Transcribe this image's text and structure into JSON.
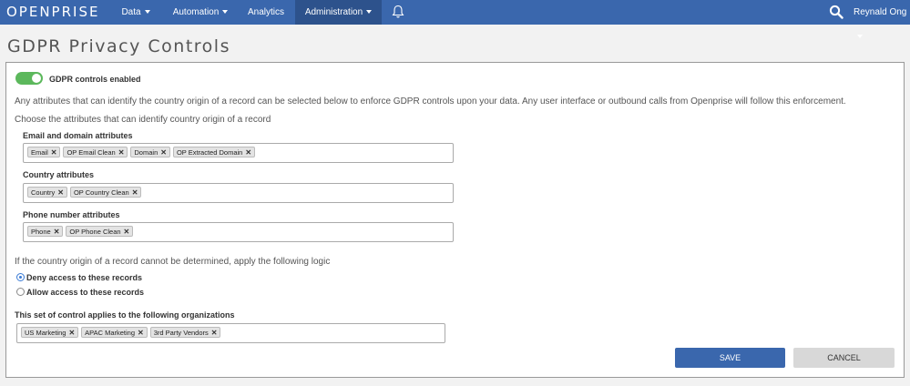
{
  "nav": {
    "logo": "OPENPRISE",
    "items": [
      {
        "label": "Data",
        "dropdown": true
      },
      {
        "label": "Automation",
        "dropdown": true
      },
      {
        "label": "Analytics",
        "dropdown": false
      },
      {
        "label": "Administration",
        "dropdown": true,
        "active": true
      }
    ],
    "user": "Reynald Ong",
    "bg_color": "#3a67ad"
  },
  "page": {
    "title": "GDPR Privacy Controls"
  },
  "gdpr": {
    "toggle_label": "GDPR controls enabled",
    "toggle_on": true,
    "description": "Any attributes that can identify the country origin of a record can be selected below to enforce GDPR controls upon your data. Any user interface or outbound calls from Openprise will follow this enforcement.",
    "choose_label": "Choose the attributes that can identify country origin of a record",
    "email_group": {
      "label": "Email and domain attributes",
      "tags": [
        "Email",
        "OP Email Clean",
        "Domain",
        "OP Extracted Domain"
      ]
    },
    "country_group": {
      "label": "Country attributes",
      "tags": [
        "Country",
        "OP Country Clean"
      ]
    },
    "phone_group": {
      "label": "Phone number attributes",
      "tags": [
        "Phone",
        "OP Phone Clean"
      ]
    },
    "logic_label": "If the country origin of a record cannot be determined, apply the following logic",
    "deny_label": "Deny access to these records",
    "allow_label": "Allow access to these records",
    "selected_logic": "deny",
    "org_group": {
      "label": "This set of control applies to the following organizations",
      "tags": [
        "US Marketing",
        "APAC Marketing",
        "3rd Party Vendors"
      ]
    },
    "save_label": "SAVE",
    "cancel_label": "CANCEL"
  }
}
